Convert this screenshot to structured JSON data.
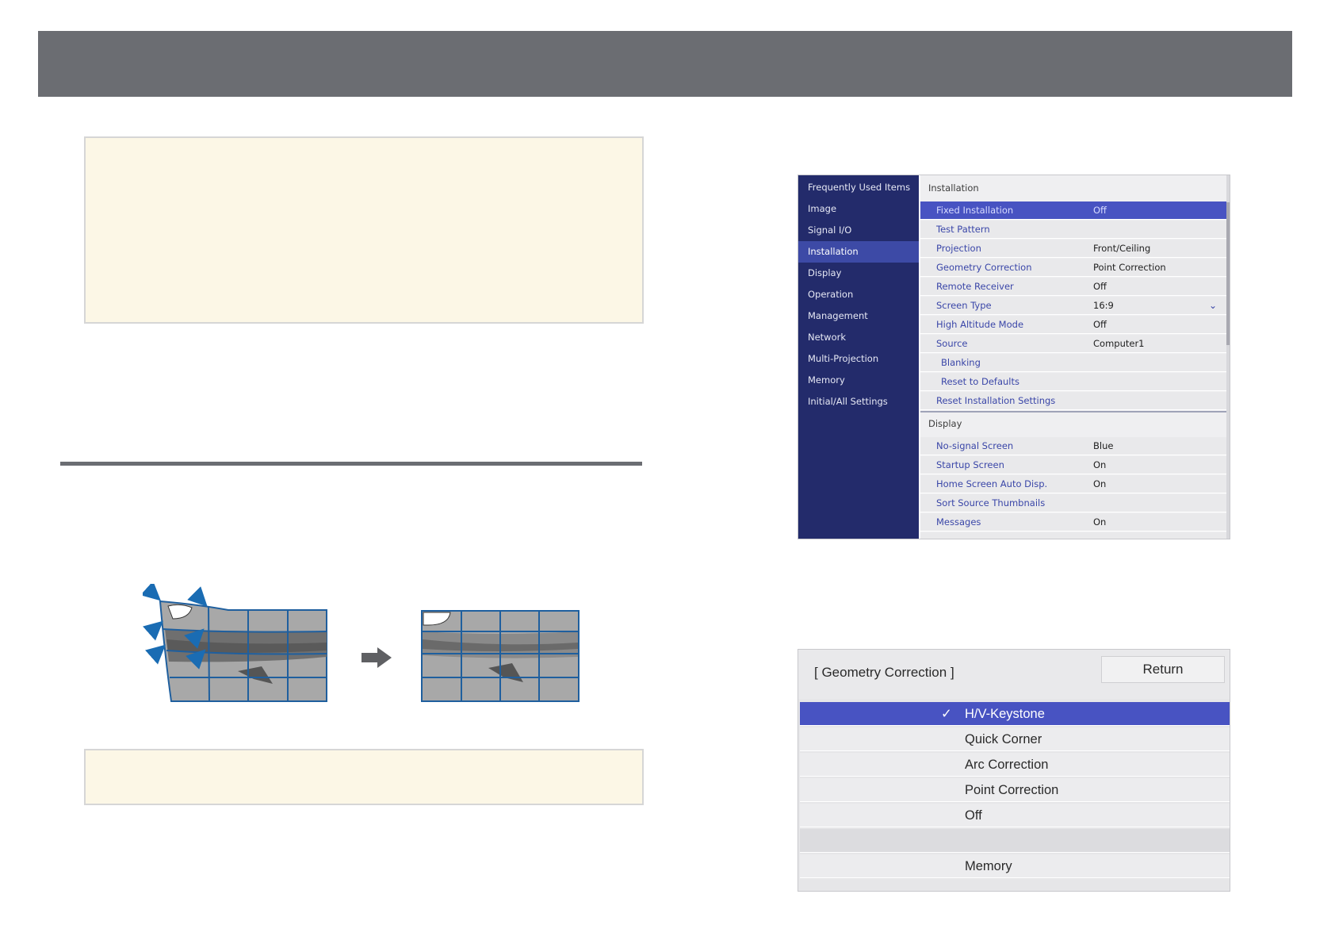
{
  "installation_menu": {
    "sidebar": [
      {
        "label": "Frequently Used Items"
      },
      {
        "label": "Image"
      },
      {
        "label": "Signal I/O"
      },
      {
        "label": "Installation",
        "active": true
      },
      {
        "label": "Display"
      },
      {
        "label": "Operation"
      },
      {
        "label": "Management"
      },
      {
        "label": "Network"
      },
      {
        "label": "Multi-Projection"
      },
      {
        "label": "Memory"
      },
      {
        "label": "Initial/All Settings"
      }
    ],
    "installation_heading": "Installation",
    "installation_rows": [
      {
        "label": "Fixed Installation",
        "value": "Off",
        "selected": true
      },
      {
        "label": "Test Pattern",
        "value": ""
      },
      {
        "label": "Projection",
        "value": "Front/Ceiling"
      },
      {
        "label": "Geometry Correction",
        "value": "Point Correction"
      },
      {
        "label": "Remote Receiver",
        "value": "Off"
      },
      {
        "label": "Screen Type",
        "value": "16:9"
      },
      {
        "label": "High Altitude Mode",
        "value": "Off"
      },
      {
        "label": "Source",
        "value": "Computer1"
      },
      {
        "label": "Blanking",
        "value": ""
      },
      {
        "label": "Reset to Defaults",
        "value": ""
      },
      {
        "label": "Reset Installation Settings",
        "value": ""
      }
    ],
    "display_heading": "Display",
    "display_rows": [
      {
        "label": "No-signal Screen",
        "value": "Blue"
      },
      {
        "label": "Startup Screen",
        "value": "On"
      },
      {
        "label": "Home Screen Auto Disp.",
        "value": "On"
      },
      {
        "label": "Sort Source Thumbnails",
        "value": ""
      },
      {
        "label": "Messages",
        "value": "On"
      }
    ],
    "colors": {
      "sidebar": "#232b6b",
      "selected": "#4853c2",
      "label_text": "#3a46a8"
    }
  },
  "geometry_dialog": {
    "title": "[ Geometry Correction ]",
    "return_label": "Return",
    "options": [
      {
        "label": "H/V-Keystone",
        "selected": true
      },
      {
        "label": "Quick Corner"
      },
      {
        "label": "Arc Correction"
      },
      {
        "label": "Point Correction"
      },
      {
        "label": "Off"
      },
      {
        "label": ""
      },
      {
        "label": "Memory"
      }
    ]
  },
  "illustration": {
    "icons": [
      "blue-arrow-icon",
      "right-arrow-icon"
    ],
    "colors": {
      "grid": "#1f5f9e",
      "arrow": "#5f6063"
    }
  }
}
